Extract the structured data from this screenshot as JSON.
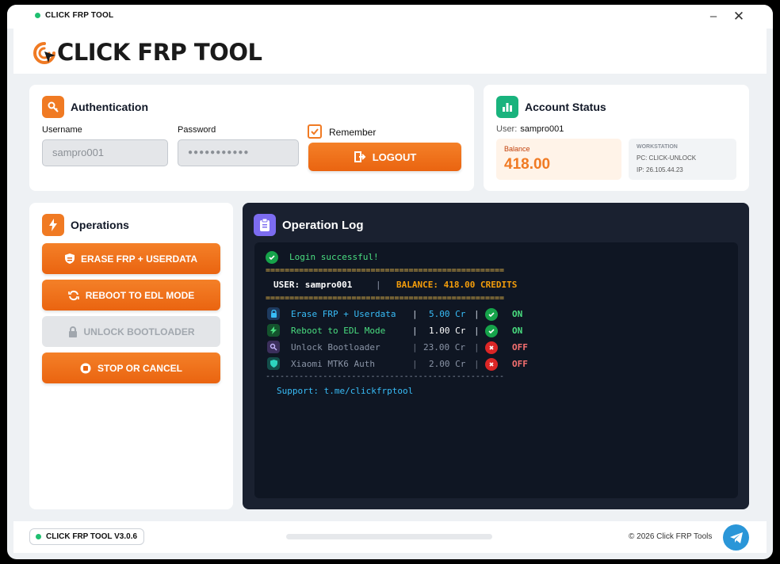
{
  "window": {
    "title": "CLICK FRP TOOL",
    "minimize_glyph": "–",
    "close_glyph": "✕"
  },
  "header": {
    "logo_text": "CLICK FRP TOOL"
  },
  "auth": {
    "title": "Authentication",
    "username_label": "Username",
    "username_value": "sampro001",
    "password_label": "Password",
    "password_value": "●●●●●●●●●●●",
    "remember_label": "Remember",
    "remember_checked": true,
    "logout_label": "LOGOUT"
  },
  "account": {
    "title": "Account Status",
    "user_label": "User:",
    "user_value": "sampro001",
    "balance_label": "Balance",
    "balance_value": "418.00",
    "workstation_title": "WORKSTATION",
    "pc": "PC: CLICK-UNLOCK",
    "ip": "IP: 26.105.44.23"
  },
  "operations": {
    "title": "Operations",
    "buttons": [
      {
        "label": "ERASE FRP + USERDATA",
        "icon": "shield-icon",
        "enabled": true
      },
      {
        "label": "REBOOT TO EDL MODE",
        "icon": "refresh-icon",
        "enabled": true
      },
      {
        "label": "UNLOCK BOOTLOADER",
        "icon": "lock-icon",
        "enabled": false
      },
      {
        "label": "STOP OR CANCEL",
        "icon": "stop-icon",
        "enabled": true
      }
    ]
  },
  "log": {
    "title": "Operation Log",
    "login_message": "Login successful!",
    "separator": "==================================================",
    "separator_dash": "--------------------------------------------------",
    "user_text": "USER: sampro001",
    "pipe": "|",
    "balance_text": "BALANCE: 418.00 CREDITS",
    "rows": [
      {
        "name": "Erase FRP + Userdata",
        "cost": "5.00 Cr",
        "status": "ON",
        "icon": "lock-icon",
        "color": "#38bdf8"
      },
      {
        "name": "Reboot to EDL Mode",
        "cost": "1.00 Cr",
        "status": "ON",
        "icon": "bolt-icon",
        "color": "#4ade80"
      },
      {
        "name": "Unlock Bootloader",
        "cost": "23.00 Cr",
        "status": "OFF",
        "icon": "key-icon",
        "color": "#8a94a6"
      },
      {
        "name": "Xiaomi MTK6 Auth",
        "cost": "2.00 Cr",
        "status": "OFF",
        "icon": "shield-icon",
        "color": "#8a94a6"
      }
    ],
    "support": "Support: t.me/clickfrptool"
  },
  "footer": {
    "version": "CLICK FRP TOOL V3.0.6",
    "progress": 0,
    "copyright": "© 2026 Click FRP Tools"
  },
  "colors": {
    "accent": "#f07a23",
    "success": "#1fbf70",
    "log_bg": "#0f1623"
  }
}
